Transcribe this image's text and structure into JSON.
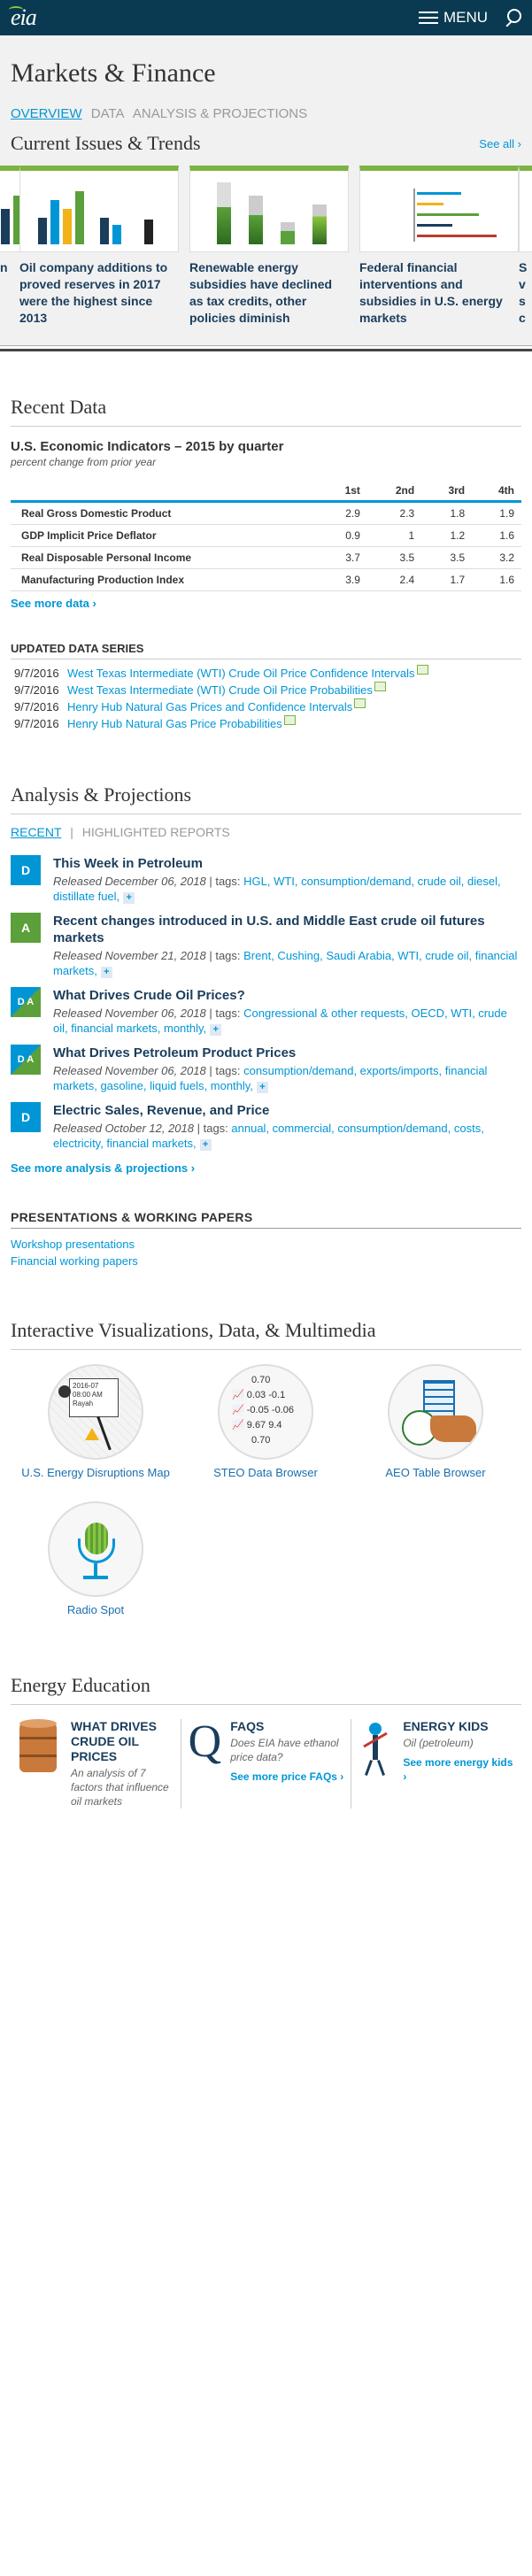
{
  "header": {
    "logo": "eia",
    "menu_label": "MENU"
  },
  "page_title": "Markets & Finance",
  "nav_tabs": [
    {
      "label": "OVERVIEW",
      "active": true
    },
    {
      "label": "DATA"
    },
    {
      "label": "ANALYSIS & PROJECTIONS"
    }
  ],
  "issues": {
    "title": "Current Issues & Trends",
    "see_all": "See all ›",
    "cards": [
      {
        "title": "n"
      },
      {
        "title": "Oil company additions to proved reserves in 2017 were the highest since 2013"
      },
      {
        "title": "Renewable energy subsidies have declined as tax credits, other policies diminish"
      },
      {
        "title": "Federal financial interventions and subsidies in U.S. energy markets"
      },
      {
        "title": "S v s c"
      }
    ]
  },
  "recent_data": {
    "title": "Recent Data",
    "indicators_title": "U.S. Economic Indicators – 2015 by quarter",
    "indicators_sub": "percent change from prior year",
    "columns": [
      "1st",
      "2nd",
      "3rd",
      "4th"
    ],
    "rows": [
      {
        "label": "Real Gross Domestic Product",
        "v": [
          "2.9",
          "2.3",
          "1.8",
          "1.9"
        ]
      },
      {
        "label": "GDP Implicit Price Deflator",
        "v": [
          "0.9",
          "1",
          "1.2",
          "1.6"
        ]
      },
      {
        "label": "Real Disposable Personal Income",
        "v": [
          "3.7",
          "3.5",
          "3.5",
          "3.2"
        ]
      },
      {
        "label": "Manufacturing Production Index",
        "v": [
          "3.9",
          "2.4",
          "1.7",
          "1.6"
        ]
      }
    ],
    "see_more": "See more data ›"
  },
  "updated": {
    "title": "UPDATED DATA SERIES",
    "items": [
      {
        "date": "9/7/2016",
        "label": "West Texas Intermediate (WTI) Crude Oil Price Confidence Intervals"
      },
      {
        "date": "9/7/2016",
        "label": "West Texas Intermediate (WTI) Crude Oil Price Probabilities"
      },
      {
        "date": "9/7/2016",
        "label": "Henry Hub Natural Gas Prices and Confidence Intervals"
      },
      {
        "date": "9/7/2016",
        "label": "Henry Hub Natural Gas Price Probabilities"
      }
    ]
  },
  "analysis": {
    "title": "Analysis & Projections",
    "tab_recent": "RECENT",
    "tab_sep": "|",
    "tab_highlighted": "HIGHLIGHTED REPORTS",
    "items": [
      {
        "badge": "D",
        "title": "This Week in Petroleum",
        "released": "Released December 06, 2018",
        "tags_label": " | tags: ",
        "tags": "HGL, WTI, consumption/demand, crude oil, diesel, distillate fuel,"
      },
      {
        "badge": "A",
        "title": "Recent changes introduced in U.S. and Middle East crude oil futures markets",
        "released": "Released November 21, 2018",
        "tags_label": " | tags: ",
        "tags": "Brent, Cushing, Saudi Arabia, WTI, crude oil, financial markets,"
      },
      {
        "badge": "D A",
        "title": "What Drives Crude Oil Prices?",
        "released": "Released November 06, 2018",
        "tags_label": " | tags: ",
        "tags": "Congressional & other requests, OECD, WTI, crude oil, financial markets, monthly,"
      },
      {
        "badge": "D A",
        "title": "What Drives Petroleum Product Prices",
        "released": "Released November 06, 2018",
        "tags_label": " | tags: ",
        "tags": "consumption/demand, exports/imports, financial markets, gasoline, liquid fuels, monthly,"
      },
      {
        "badge": "D",
        "title": "Electric Sales, Revenue, and Price",
        "released": "Released October 12, 2018",
        "tags_label": " | tags: ",
        "tags": "annual, commercial, consumption/demand, costs, electricity, financial markets,"
      }
    ],
    "plus": "+",
    "see_more": "See more analysis & projections ›"
  },
  "presentations": {
    "title": "PRESENTATIONS & WORKING PAPERS",
    "links": [
      "Workshop presentations",
      "Financial working papers"
    ]
  },
  "viz": {
    "title": "Interactive Visualizations, Data, & Multimedia",
    "items": [
      {
        "label": "U.S. Energy Disruptions Map",
        "icon": "map-icon"
      },
      {
        "label": "STEO Data Browser",
        "icon": "chart-icon"
      },
      {
        "label": "AEO Table Browser",
        "icon": "table-icon"
      },
      {
        "label": "Radio Spot",
        "icon": "microphone-icon"
      }
    ],
    "map_text": [
      "2016-07",
      "08:00 AM",
      "Rayah"
    ],
    "steo_values": [
      "0.70",
      "0.03",
      "-0.1",
      "-0.05",
      "-0.06",
      "9.67",
      "9.4",
      "0.70"
    ]
  },
  "education": {
    "title": "Energy Education",
    "cols": [
      {
        "title": "WHAT DRIVES CRUDE OIL PRICES",
        "text": "An analysis of 7 factors that influence oil markets",
        "link": ""
      },
      {
        "title": "FAQS",
        "text": "Does EIA have ethanol price data?",
        "link": "See more price FAQs ›"
      },
      {
        "title": "ENERGY KIDS",
        "text": "Oil (petroleum)",
        "link": "See more energy kids ›"
      }
    ]
  }
}
